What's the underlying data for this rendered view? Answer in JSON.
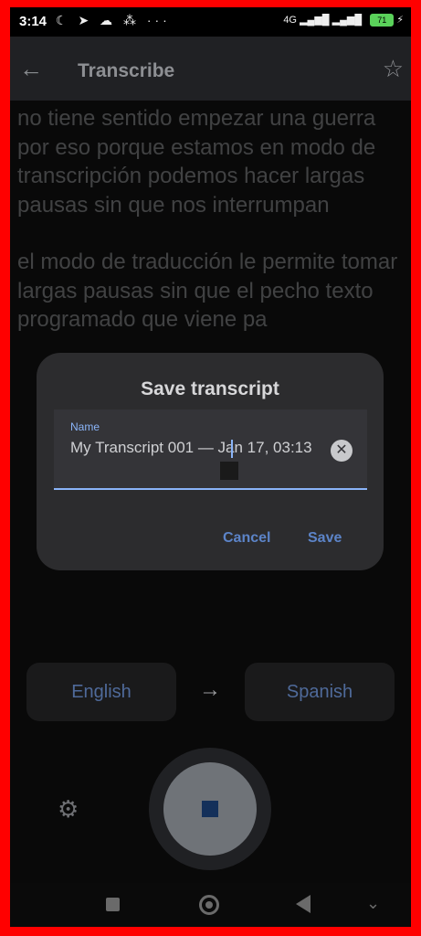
{
  "status_bar": {
    "time": "3:14",
    "left_icons": "☾ ➤ ☁ ⁂  ···",
    "network": "4G",
    "battery": "71"
  },
  "app_bar": {
    "title": "Transcribe",
    "back_icon": "arrow-left-icon",
    "star_icon": "star-outline-icon"
  },
  "transcript": {
    "paragraph1": "no tiene sentido empezar una guerra por eso porque estamos en modo de transcripción podemos hacer largas pausas sin que nos interrumpan",
    "paragraph2": "el modo de traducción le permite tomar largas pausas sin que el pecho texto programado que viene pa"
  },
  "dialog": {
    "title": "Save transcript",
    "field_label": "Name",
    "field_value": "My Transcript 001 — Jan 17, 03:13",
    "cancel_label": "Cancel",
    "save_label": "Save"
  },
  "languages": {
    "source": "English",
    "target": "Spanish",
    "arrow": "→"
  },
  "colors": {
    "accent": "#8ab4f8",
    "dialog_bg": "#2c2c2e",
    "background": "#121212",
    "border": "#ff0000"
  }
}
